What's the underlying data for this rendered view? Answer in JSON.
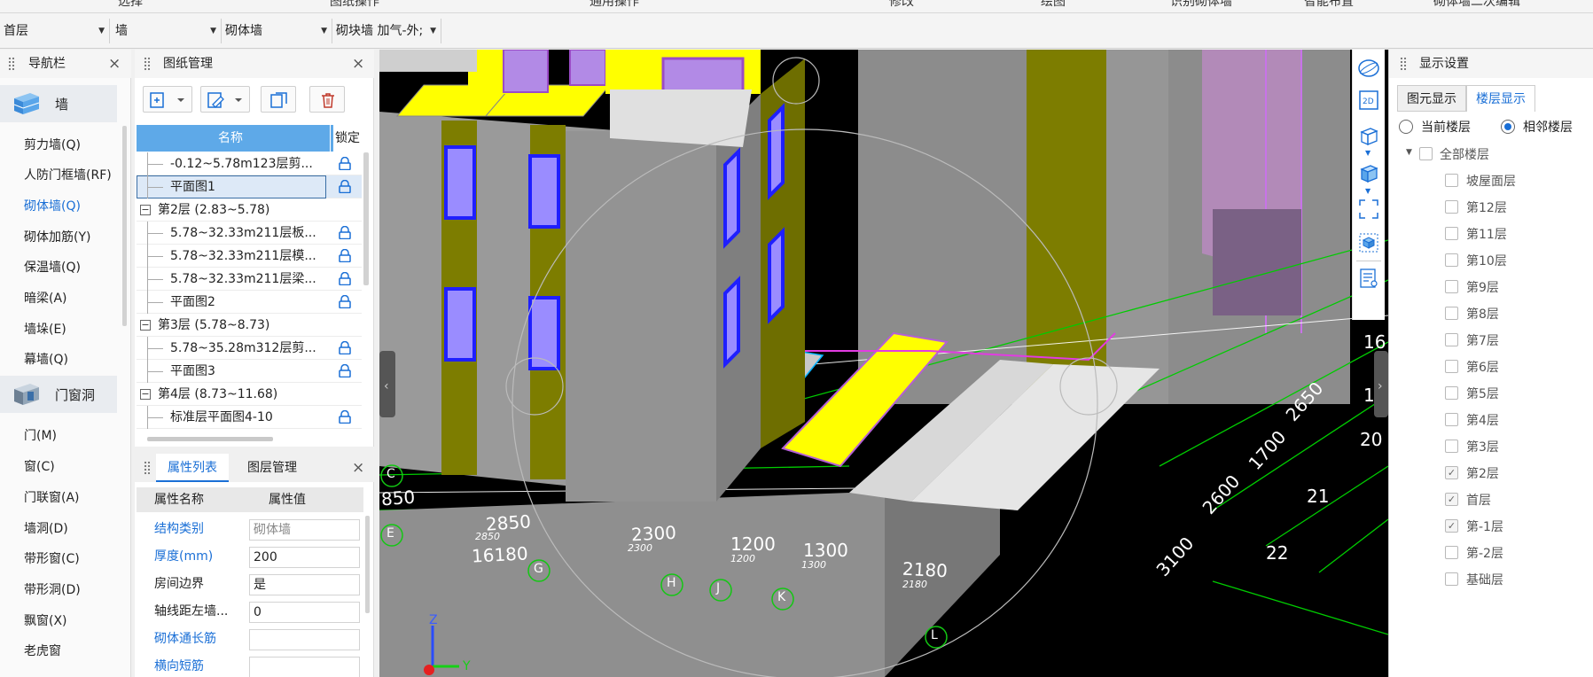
{
  "menu": [
    "选择",
    "图纸操作",
    "通用操作",
    "修改",
    "绘图",
    "识别砌体墙",
    "智能布置",
    "砌体墙二次编辑"
  ],
  "toolbar": {
    "floor": "首层",
    "category": "墙",
    "type": "砌体墙",
    "subtype": "砌块墙 加气-外;"
  },
  "nav": {
    "title": "导航栏",
    "categories": [
      "墙",
      "门窗洞"
    ],
    "wall_items": [
      "剪力墙(Q)",
      "人防门框墙(RF)",
      "砌体墙(Q)",
      "砌体加筋(Y)",
      "保温墙(Q)",
      "暗梁(A)",
      "墙垛(E)",
      "幕墙(Q)"
    ],
    "door_items": [
      "门(M)",
      "窗(C)",
      "门联窗(A)",
      "墙洞(D)",
      "带形窗(C)",
      "带形洞(D)",
      "飘窗(X)",
      "老虎窗"
    ]
  },
  "drawings": {
    "title": "图纸管理",
    "col_name": "名称",
    "col_lock": "锁定",
    "rows": [
      {
        "label": "-0.12~5.78m123层剪...",
        "indent": 2
      },
      {
        "label": "平面图1",
        "indent": 2,
        "selected": true
      },
      {
        "label": "第2层 (2.83~5.78)",
        "indent": 1,
        "group": true
      },
      {
        "label": "5.78~32.33m211层板...",
        "indent": 2
      },
      {
        "label": "5.78~32.33m211层模...",
        "indent": 2
      },
      {
        "label": "5.78~32.33m211层梁...",
        "indent": 2
      },
      {
        "label": "平面图2",
        "indent": 2
      },
      {
        "label": "第3层 (5.78~8.73)",
        "indent": 1,
        "group": true
      },
      {
        "label": "5.78~35.28m312层剪...",
        "indent": 2
      },
      {
        "label": "平面图3",
        "indent": 2
      },
      {
        "label": "第4层 (8.73~11.68)",
        "indent": 1,
        "group": true
      },
      {
        "label": "标准层平面图4-10",
        "indent": 2
      }
    ]
  },
  "props": {
    "tab1": "属性列表",
    "tab2": "图层管理",
    "col_name": "属性名称",
    "col_value": "属性值",
    "rows": [
      {
        "k": "结构类别",
        "v": "砌体墙",
        "blue": true,
        "gray": true
      },
      {
        "k": "厚度(mm)",
        "v": "200",
        "blue": true
      },
      {
        "k": "房间边界",
        "v": "是"
      },
      {
        "k": "轴线距左墙...",
        "v": "0"
      },
      {
        "k": "砌体通长筋",
        "v": "",
        "blue": true
      },
      {
        "k": "横向短筋",
        "v": "",
        "blue": true
      }
    ]
  },
  "display": {
    "title": "显示设置",
    "tab1": "图元显示",
    "tab2": "楼层显示",
    "radio1": "当前楼层",
    "radio2": "相邻楼层",
    "all_floors": "全部楼层",
    "floors": [
      {
        "n": "坡屋面层",
        "c": false
      },
      {
        "n": "第12层",
        "c": false
      },
      {
        "n": "第11层",
        "c": false
      },
      {
        "n": "第10层",
        "c": false
      },
      {
        "n": "第9层",
        "c": false
      },
      {
        "n": "第8层",
        "c": false
      },
      {
        "n": "第7层",
        "c": false
      },
      {
        "n": "第6层",
        "c": false
      },
      {
        "n": "第5层",
        "c": false
      },
      {
        "n": "第4层",
        "c": false
      },
      {
        "n": "第3层",
        "c": false
      },
      {
        "n": "第2层",
        "c": true
      },
      {
        "n": "首层",
        "c": true
      },
      {
        "n": "第-1层",
        "c": true
      },
      {
        "n": "第-2层",
        "c": false
      },
      {
        "n": "基础层",
        "c": false
      }
    ]
  },
  "viewport": {
    "dims": [
      "850",
      "2850",
      "2850",
      "16180",
      "2300",
      "2300",
      "1200",
      "1200",
      "1300",
      "1300",
      "2180",
      "2180",
      "3100",
      "2600",
      "1700",
      "2650"
    ],
    "axes": [
      "C",
      "E",
      "G",
      "H",
      "J",
      "K",
      "L"
    ],
    "right_numbers": [
      "16",
      "1",
      "20",
      "21",
      "22"
    ],
    "axis_labels": [
      "Z",
      "Y"
    ]
  },
  "colors": {
    "accent": "#1a6fd6",
    "header_blue": "#5ea9e8",
    "wall_gray": "#8a8a8a",
    "wall_yellow": "#ffff00",
    "olive": "#7a7a00"
  },
  "icons": [
    "wall-icon",
    "door-window-icon",
    "add-drawing-icon",
    "edit-drawing-icon",
    "copy-drawing-icon",
    "delete-icon",
    "lock-icon",
    "sphere-view-icon",
    "2d-icon",
    "cube-icon",
    "cube-solid-icon",
    "fullscreen-icon",
    "3d-box-icon",
    "properties-icon"
  ]
}
